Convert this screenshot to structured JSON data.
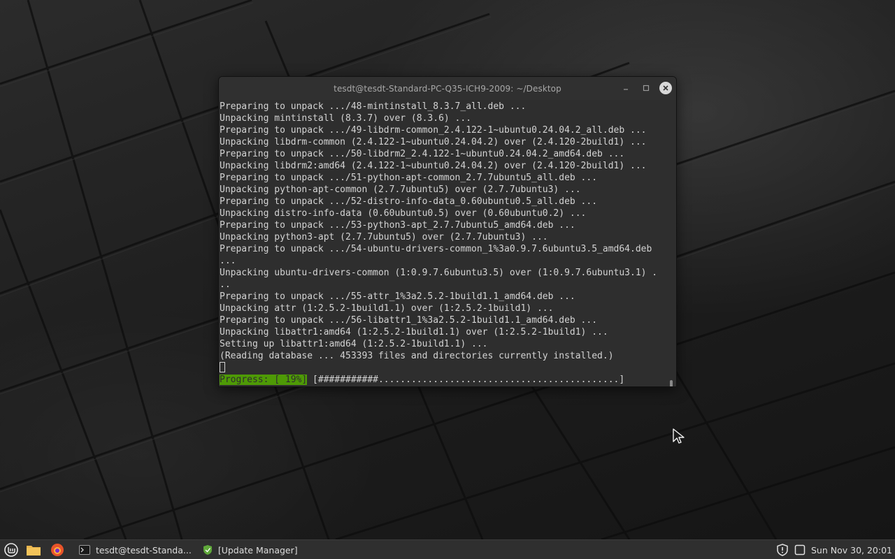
{
  "terminal": {
    "title": "tesdt@tesdt-Standard-PC-Q35-ICH9-2009: ~/Desktop",
    "controls": {
      "minimize": "_",
      "maximize": "□",
      "close": "✕"
    },
    "lines": [
      "Preparing to unpack .../48-mintinstall_8.3.7_all.deb ...",
      "Unpacking mintinstall (8.3.7) over (8.3.6) ...",
      "Preparing to unpack .../49-libdrm-common_2.4.122-1~ubuntu0.24.04.2_all.deb ...",
      "Unpacking libdrm-common (2.4.122-1~ubuntu0.24.04.2) over (2.4.120-2build1) ...",
      "Preparing to unpack .../50-libdrm2_2.4.122-1~ubuntu0.24.04.2_amd64.deb ...",
      "Unpacking libdrm2:amd64 (2.4.122-1~ubuntu0.24.04.2) over (2.4.120-2build1) ...",
      "Preparing to unpack .../51-python-apt-common_2.7.7ubuntu5_all.deb ...",
      "Unpacking python-apt-common (2.7.7ubuntu5) over (2.7.7ubuntu3) ...",
      "Preparing to unpack .../52-distro-info-data_0.60ubuntu0.5_all.deb ...",
      "Unpacking distro-info-data (0.60ubuntu0.5) over (0.60ubuntu0.2) ...",
      "Preparing to unpack .../53-python3-apt_2.7.7ubuntu5_amd64.deb ...",
      "Unpacking python3-apt (2.7.7ubuntu5) over (2.7.7ubuntu3) ...",
      "Preparing to unpack .../54-ubuntu-drivers-common_1%3a0.9.7.6ubuntu3.5_amd64.deb",
      "...",
      "Unpacking ubuntu-drivers-common (1:0.9.7.6ubuntu3.5) over (1:0.9.7.6ubuntu3.1) .",
      "..",
      "Preparing to unpack .../55-attr_1%3a2.5.2-1build1.1_amd64.deb ...",
      "Unpacking attr (1:2.5.2-1build1.1) over (1:2.5.2-1build1) ...",
      "Preparing to unpack .../56-libattr1_1%3a2.5.2-1build1.1_amd64.deb ...",
      "Unpacking libattr1:amd64 (1:2.5.2-1build1.1) over (1:2.5.2-1build1) ...",
      "Setting up libattr1:amd64 (1:2.5.2-1build1.1) ...",
      "(Reading database ... 453393 files and directories currently installed.)"
    ],
    "progress_label": "Progress: [ 19%]",
    "progress_bar": " [###########............................................]",
    "progress_percent": 19,
    "colors": {
      "progress_bg": "#4e9a06",
      "text": "#d3d3d3",
      "background": "#2e2e2e"
    }
  },
  "taskbar": {
    "menu_icon": "linux-mint-menu-icon",
    "launchers": [
      "files-folder-icon",
      "firefox-icon"
    ],
    "tasks": [
      {
        "label": "tesdt@tesdt-Standa...",
        "icon": "terminal-icon"
      },
      {
        "label": "[Update Manager]",
        "icon": "shield-icon"
      }
    ],
    "tray": [
      "update-shield-icon",
      "notifications-icon"
    ],
    "clock": "Sun Nov 30, 20:01"
  }
}
